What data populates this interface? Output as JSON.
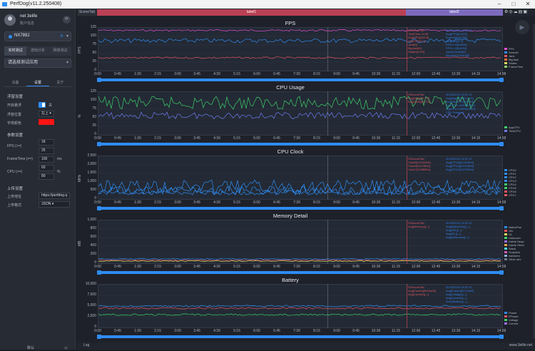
{
  "window": {
    "title": "PerfDog(v11.2.250408)"
  },
  "sidebar": {
    "user_name": "net 3elife",
    "user_sub": "账户信息",
    "device_name": "NX789J",
    "mode_tabs": [
      "实时测试",
      "游戏分析",
      "网络测试"
    ],
    "app_select": "请选择测试应用",
    "sub_tabs": [
      "设备",
      "设置",
      "关于"
    ],
    "float_section": "浮窗设置",
    "float_open_label": "开启悬浮",
    "float_open_value": "关",
    "float_pos_label": "浮窗位置",
    "float_pos_value": "左上",
    "font_color_label": "字体颜色",
    "font_color": "#ff1414",
    "param_section": "参数设置",
    "fps_label": "FPS (>=)",
    "fps_values": [
      "18",
      "25"
    ],
    "frametime_label": "FrameTime (>=)",
    "frametime_value": "100",
    "frametime_unit": "ms",
    "cpu_label": "CPU (>=)",
    "cpu_values": [
      "60",
      "80"
    ],
    "cpu_unit": "%",
    "upload_section": "上传设置",
    "upload_url_label": "上传地址",
    "upload_url_value": "https://perfdog.q",
    "upload_fmt_label": "上传格式",
    "upload_fmt_value": "JSON",
    "default_btn": "默认"
  },
  "toolbar": {
    "scene_tab": "SceneTab",
    "label1": "label1",
    "label2": "label2",
    "icons": [
      "settings-icon",
      "location-icon",
      "cloud-icon",
      "folder-icon",
      "screenshot-icon"
    ]
  },
  "x_ticks": [
    "0:00",
    "0:45",
    "1:30",
    "2:15",
    "3:00",
    "3:45",
    "4:30",
    "5:15",
    "6:00",
    "6:45",
    "7:30",
    "8:15",
    "9:00",
    "9:45",
    "10:30",
    "11:15",
    "12:00",
    "12:45",
    "13:30",
    "14:15",
    "14:58"
  ],
  "charts": [
    {
      "title": "FPS",
      "ylabel": "FPS",
      "yticks": [
        "125",
        "100",
        "75",
        "50",
        "25",
        "0"
      ],
      "legend": [
        {
          "name": "FPS",
          "color": "#e04fd3"
        },
        {
          "name": "Smooth",
          "color": "#2f8cf3"
        },
        {
          "name": "Jank",
          "color": "#e05561"
        },
        {
          "name": "BigJank",
          "color": "#ff6a3d"
        },
        {
          "name": "Stutter",
          "color": "#d8d85a"
        },
        {
          "name": "FrameTime",
          "color": "#8fd06a"
        }
      ],
      "left_info": [
        "Ѕ0SceneTab",
        "TotalTime 14:58",
        "Avg(FPS)[119.8]",
        "Var(FPS)[0.1]",
        "Jank[0]",
        "BigJank[0]",
        "Stutter[0.0%]"
      ],
      "right_info": [
        "00:00/2024 14:57:10",
        "Avg(FPS)[120.0]",
        "Smooth[100.0%]",
        "Var(FPS)[0.1]",
        "FPS>=18[100%]",
        "FPS>=25[100%]",
        "Jank(/10min)[0]",
        "BigJank(/10min)[0]"
      ]
    },
    {
      "title": "CPU Usage",
      "ylabel": "%",
      "yticks": [
        "125",
        "100",
        "75",
        "50",
        "25",
        "0"
      ],
      "legend": [
        {
          "name": "AppCPU",
          "color": "#3dd06a"
        },
        {
          "name": "TotalCPU",
          "color": "#6f7cf3"
        }
      ],
      "left_info": [
        "Ѕ0SceneTab",
        "Avg(App)[22.7%]",
        "Avg(Total)[34.2%]"
      ],
      "right_info": [
        "00:00/2024 14:57:10",
        "Avg(AppCPU)[19.4%]",
        "Avg(TotalCPU)[38.9%]",
        "AppCPU<=60%[100%]",
        "AppCPU<=80%[100%]",
        "CPU Temp[—]"
      ]
    },
    {
      "title": "CPU Clock",
      "ylabel": "MHz",
      "yticks": [
        "2,500",
        "2,000",
        "1,500",
        "1,000",
        "500",
        "0"
      ],
      "legend": [
        {
          "name": "CPU0",
          "color": "#2f8cf3"
        },
        {
          "name": "CPU1",
          "color": "#2f8cf3"
        },
        {
          "name": "CPU2",
          "color": "#2f8cf3"
        },
        {
          "name": "CPU3",
          "color": "#2f8cf3"
        },
        {
          "name": "CPU4",
          "color": "#3dd06a"
        },
        {
          "name": "CPU5",
          "color": "#3dd06a"
        },
        {
          "name": "CPU6",
          "color": "#e05561"
        },
        {
          "name": "CPU7",
          "color": "#e05561"
        }
      ],
      "left_info": [
        "Ѕ0SceneTab",
        "Clock0[1014MHz]",
        "Clock4[1121MHz]",
        "Clock7[1198MHz]"
      ],
      "right_info": [
        "00:00/2024 14:57:10",
        "Avg(CPU0)[1011MHz]",
        "Avg(CPU4)[1121MHz]",
        "Avg(CPU7)[1197MHz]"
      ]
    },
    {
      "title": "Memory Detail",
      "ylabel": "MB",
      "yticks": [
        "1,000",
        "800",
        "600",
        "400",
        "200",
        "0"
      ],
      "legend": [
        {
          "name": "NativePss",
          "color": "#2f8cf3"
        },
        {
          "name": "Gfx",
          "color": "#e05561"
        },
        {
          "name": "GL",
          "color": "#d8d85a"
        },
        {
          "name": "Unknown",
          "color": "#3dd06a"
        },
        {
          "name": "Dalvik Heap",
          "color": "#9a6df3"
        },
        {
          "name": "Dalvik Other",
          "color": "#e0a34f"
        },
        {
          "name": "Stack",
          "color": "#4fd6e0"
        },
        {
          "name": "Graphics",
          "color": "#d35fae"
        },
        {
          "name": "Ashmem",
          "color": "#8ab0d8"
        },
        {
          "name": "Other dev",
          "color": "#6e7b8c"
        }
      ],
      "left_info": [
        "Ѕ0SceneTab",
        "Avg(Memory)[—]"
      ],
      "right_info": [
        "00:00/2024 14:57:10",
        "Avg(NativePss)[—]",
        "Avg(Gfx)[—]",
        "Avg(GL)[—]",
        "Avg(Unknown)[—]"
      ]
    },
    {
      "title": "Battery",
      "ylabel": "",
      "yticks": [
        "10,000",
        "7,500",
        "5,000",
        "2,500",
        "0"
      ],
      "legend": [
        {
          "name": "Power",
          "color": "#2f8cf3"
        },
        {
          "name": "FPower",
          "color": "#e05561"
        },
        {
          "name": "Voltage",
          "color": "#3dd06a"
        },
        {
          "name": "Current",
          "color": "#9a6df3"
        }
      ],
      "left_info": [
        "Ѕ0SceneTab",
        "Avg(Power)[5044mW]",
        "Avg(Current)[—]"
      ],
      "right_info": [
        "00:00/2024 14:57:10",
        "Avg(Power)[5172mW]",
        "Avg(Voltage)[—]",
        "Avg(Current)[—]",
        "Sum(Battery)[—]"
      ]
    }
  ],
  "status": {
    "log": "Log",
    "watermark": "www.3elife.net"
  }
}
